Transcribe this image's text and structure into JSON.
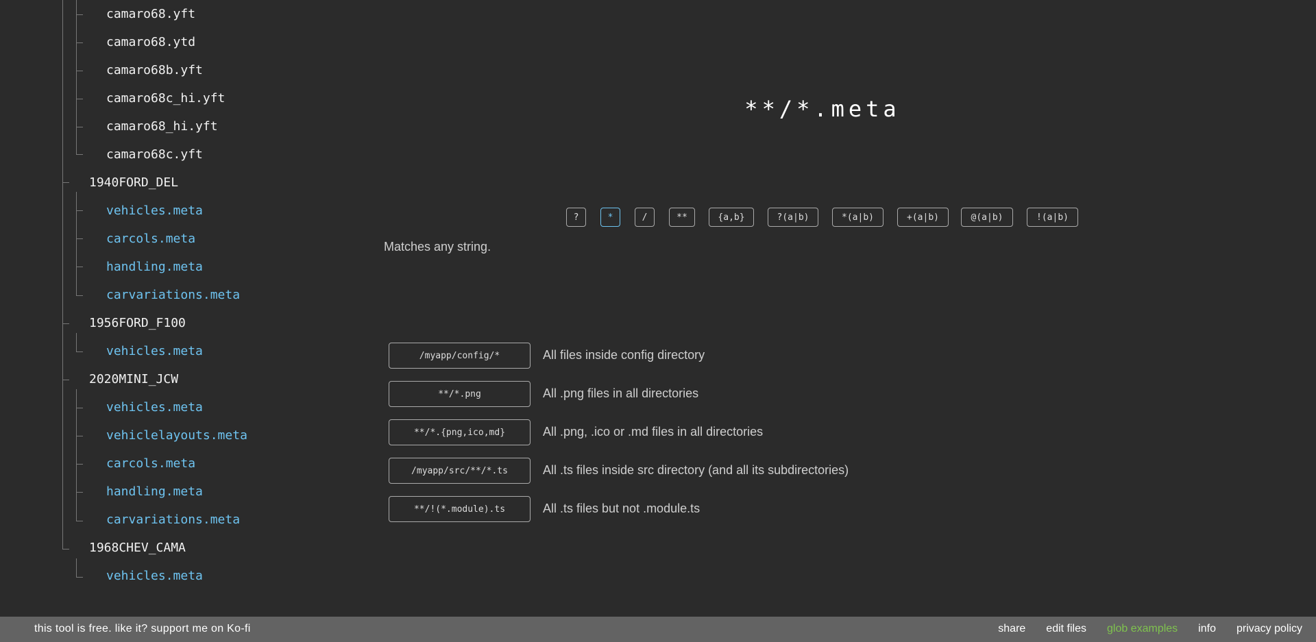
{
  "tree": {
    "items": [
      {
        "label": "camaro68.yft",
        "kind": "file",
        "match": false
      },
      {
        "label": "camaro68.ytd",
        "kind": "file",
        "match": false
      },
      {
        "label": "camaro68b.yft",
        "kind": "file",
        "match": false
      },
      {
        "label": "camaro68c_hi.yft",
        "kind": "file",
        "match": false
      },
      {
        "label": "camaro68_hi.yft",
        "kind": "file",
        "match": false
      },
      {
        "label": "camaro68c.yft",
        "kind": "file",
        "match": false
      },
      {
        "label": "1940FORD_DEL",
        "kind": "folder",
        "match": false
      },
      {
        "label": "vehicles.meta",
        "kind": "file",
        "match": true
      },
      {
        "label": "carcols.meta",
        "kind": "file",
        "match": true
      },
      {
        "label": "handling.meta",
        "kind": "file",
        "match": true
      },
      {
        "label": "carvariations.meta",
        "kind": "file",
        "match": true
      },
      {
        "label": "1956FORD_F100",
        "kind": "folder",
        "match": false
      },
      {
        "label": "vehicles.meta",
        "kind": "file",
        "match": true
      },
      {
        "label": "2020MINI_JCW",
        "kind": "folder",
        "match": false
      },
      {
        "label": "vehicles.meta",
        "kind": "file",
        "match": true
      },
      {
        "label": "vehiclelayouts.meta",
        "kind": "file",
        "match": true
      },
      {
        "label": "carcols.meta",
        "kind": "file",
        "match": true
      },
      {
        "label": "handling.meta",
        "kind": "file",
        "match": true
      },
      {
        "label": "carvariations.meta",
        "kind": "file",
        "match": true
      },
      {
        "label": "1968CHEV_CAMA",
        "kind": "folder",
        "match": false
      },
      {
        "label": "vehicles.meta",
        "kind": "file",
        "match": true
      }
    ]
  },
  "pattern": {
    "title": "**/*.meta"
  },
  "tokens": {
    "items": [
      "?",
      "*",
      "/",
      "**",
      "{a,b}",
      "?(a|b)",
      "*(a|b)",
      "+(a|b)",
      "@(a|b)",
      "!(a|b)"
    ],
    "active": "*",
    "description": "Matches any string."
  },
  "examples": [
    {
      "pattern": "/myapp/config/*",
      "description": "All files inside config directory"
    },
    {
      "pattern": "**/*.png",
      "description": "All .png files in all directories"
    },
    {
      "pattern": "**/*.{png,ico,md}",
      "description": "All .png, .ico or .md files in all directories"
    },
    {
      "pattern": "/myapp/src/**/*.ts",
      "description": "All .ts files inside src directory (and all its subdirectories)"
    },
    {
      "pattern": "**/!(*.module).ts",
      "description": "All .ts files but not .module.ts"
    }
  ],
  "footer": {
    "support_text": "this tool is free. like it? support me on Ko-fi",
    "links": [
      {
        "label": "share",
        "active": false
      },
      {
        "label": "edit files",
        "active": false
      },
      {
        "label": "glob examples",
        "active": true
      },
      {
        "label": "info",
        "active": false
      },
      {
        "label": "privacy policy",
        "active": false
      }
    ]
  },
  "colors": {
    "background": "#2b2b2b",
    "match": "#6ec3f0",
    "footer_bg": "#636363",
    "footer_active": "#7fc34e"
  }
}
